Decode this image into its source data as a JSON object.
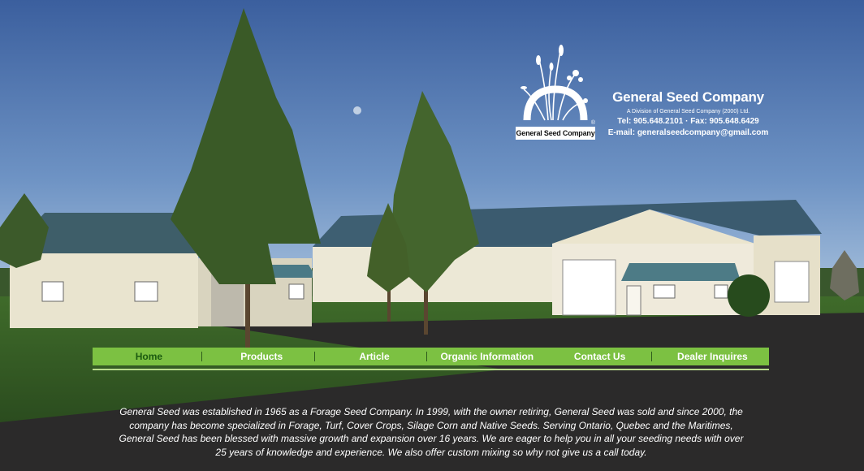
{
  "header": {
    "logo_caption": "General Seed Company",
    "logo_registered_mark": "®",
    "company_name": "General Seed Company",
    "division": "A Division of General Seed Company (2000) Ltd.",
    "tel_label": "Tel:",
    "tel": "905.648.2101",
    "fax_label": "Fax:",
    "fax": "905.648.6429",
    "separator": "·",
    "email_label": "E-mail:",
    "email": "generalseedcompany@gmail.com"
  },
  "nav": {
    "items": [
      {
        "label": "Home",
        "active": true
      },
      {
        "label": "Products",
        "active": false
      },
      {
        "label": "Article",
        "active": false
      },
      {
        "label": "Organic Information",
        "active": false
      },
      {
        "label": "Contact Us",
        "active": false
      },
      {
        "label": "Dealer Inquires",
        "active": false
      }
    ],
    "separator": "|"
  },
  "about": {
    "text": "General Seed was established in 1965 as a Forage Seed Company. In 1999, with the owner retiring, General Seed was sold and since 2000, the company has become specialized in Forage, Turf, Cover Crops, Silage Corn and Native Seeds. Serving Ontario, Quebec and the Maritimes, General Seed has been blessed with massive growth and expansion over 16 years. We are eager to help you in all your seeding needs with over 25 years of knowledge and experience. We also offer custom mixing so why not give us a call today."
  },
  "colors": {
    "nav_bg": "#7cc142",
    "nav_active_text": "#1b5a10",
    "sky_top": "#3f63a0",
    "sky_bottom": "#a9c4e0"
  }
}
